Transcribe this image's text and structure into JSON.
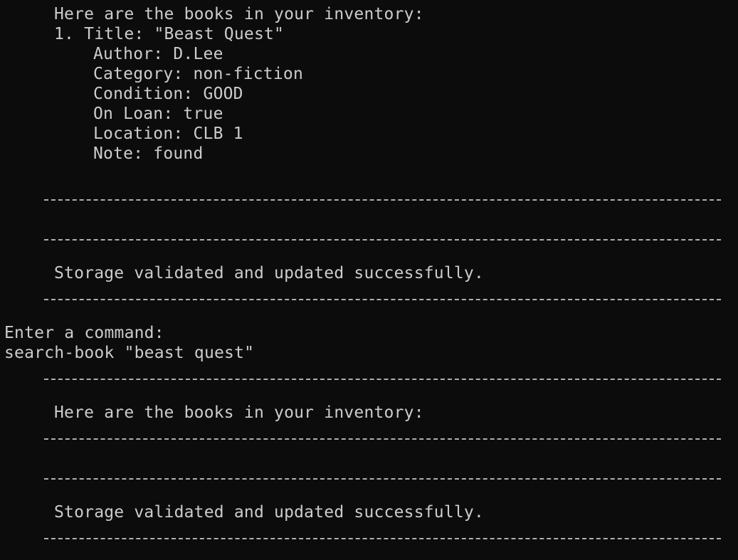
{
  "terminal": {
    "output_1": {
      "header": "Here are the books in your inventory:",
      "book_1": {
        "title_line": "1. Title: \"Beast Quest\"",
        "author": "Author: D.Lee",
        "category": "Category: non-fiction",
        "condition": "Condition: GOOD",
        "on_loan": "On Loan: true",
        "location": "Location: CLB 1",
        "note": "Note: found"
      },
      "storage_message": "Storage validated and updated successfully."
    },
    "prompt": "Enter a command:",
    "command_input": "search-book \"beast quest\"",
    "output_2": {
      "header": "Here are the books in your inventory:",
      "storage_message": "Storage validated and updated successfully."
    }
  },
  "colors": {
    "background": "#0c0c0c",
    "text": "#cccccc"
  }
}
